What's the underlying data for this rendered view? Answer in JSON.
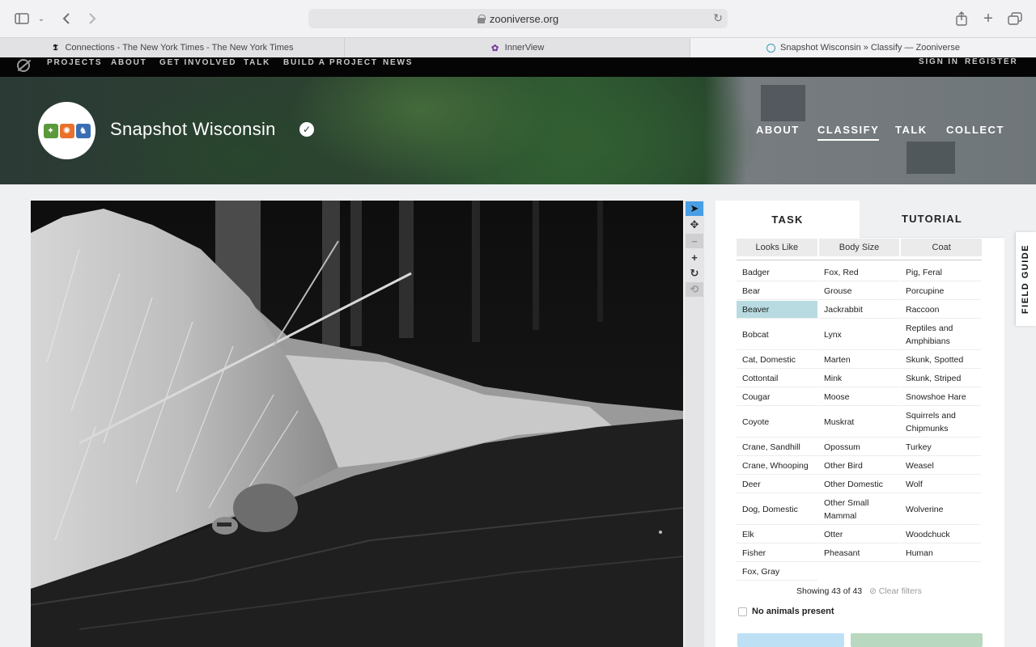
{
  "browser": {
    "url": "zooniverse.org",
    "tabs": [
      {
        "label": "Connections - The New York Times - The New York Times",
        "favicon": "nyt-icon"
      },
      {
        "label": "InnerView",
        "favicon": "innerview-icon"
      },
      {
        "label": "Snapshot Wisconsin » Classify — Zooniverse",
        "favicon": "zooniverse-icon"
      }
    ],
    "active_tab": 2
  },
  "site_nav": {
    "links": [
      "PROJECTS",
      "ABOUT",
      "GET INVOLVED",
      "TALK",
      "BUILD A PROJECT",
      "NEWS"
    ],
    "sign_in": "SIGN IN",
    "register": "REGISTER"
  },
  "project": {
    "title": "Snapshot Wisconsin",
    "verified_icon": "check-icon",
    "nav": [
      "ABOUT",
      "CLASSIFY",
      "TALK",
      "COLLECT"
    ],
    "active_nav": "CLASSIFY"
  },
  "viewer_tools": [
    "pointer-icon",
    "move-icon",
    "zoom-out-icon",
    "zoom-in-icon",
    "rotate-icon",
    "reset-icon"
  ],
  "task_panel": {
    "tabs": [
      "TASK",
      "TUTORIAL"
    ],
    "active_tab": "TASK",
    "filters": [
      "Looks Like",
      "Body Size",
      "Coat"
    ],
    "columns": [
      [
        "Badger",
        "Bear",
        "Beaver",
        "Bobcat",
        "Cat, Domestic",
        "Cottontail",
        "Cougar",
        "Coyote",
        "Crane, Sandhill",
        "Crane, Whooping",
        "Deer",
        "Dog, Domestic",
        "Elk",
        "Fisher",
        "Fox, Gray"
      ],
      [
        "Fox, Red",
        "Grouse",
        "Jackrabbit",
        "Lynx",
        "Marten",
        "Mink",
        "Moose",
        "Muskrat",
        "Opossum",
        "Other Bird",
        "Other Domestic",
        "Other Small Mammal",
        "Otter",
        "Pheasant"
      ],
      [
        "Pig, Feral",
        "Porcupine",
        "Raccoon",
        "Reptiles and Amphibians",
        "Skunk, Spotted",
        "Skunk, Striped",
        "Snowshoe Hare",
        "Squirrels and Chipmunks",
        "Turkey",
        "Weasel",
        "Wolf",
        "Wolverine",
        "Woodchuck",
        "Human"
      ]
    ],
    "highlighted": "Beaver",
    "highlight_color": "#b7dbe0",
    "showing": "Showing 43 of 43",
    "clear_filters": "Clear filters",
    "no_animals": "No animals present"
  },
  "field_guide": "FIELD GUIDE"
}
